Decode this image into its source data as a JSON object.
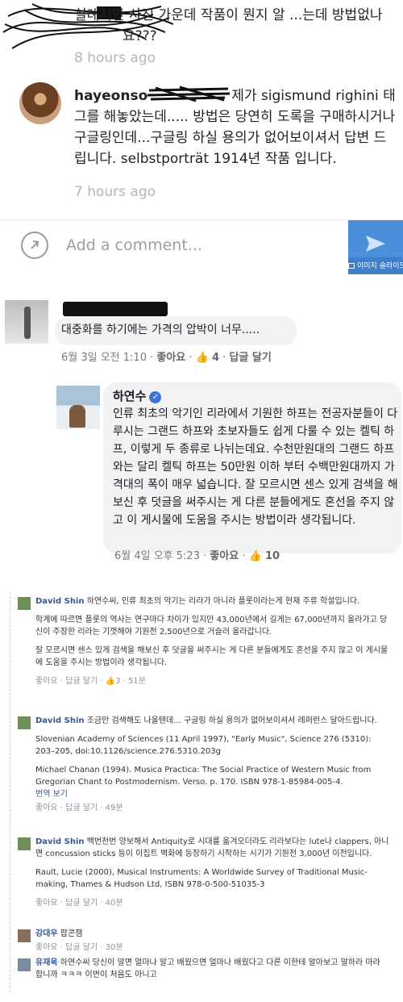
{
  "instagram": {
    "comment1": {
      "text": "실례지만 사진 가운데 작품이 뭔지 알 ...는데 방법없나요???",
      "time": "8 hours ago"
    },
    "comment2": {
      "username": "hayeonso",
      "text": "제가 sigismund righini 태그를 해놓았는데..... 방법은 당연히 도록을 구매하시거나 구글링인데...구글링 하실 용의가 없어보이셔서 답변 드립니다. selbstporträt 1914년 작품 입니다.",
      "time": "7 hours ago"
    },
    "add_comment_placeholder": "Add a comment...",
    "image_slider_label": "이미지 슬라이드"
  },
  "facebook_mobile": {
    "comment1": {
      "text": "대중화를 하기에는 가격의 압박이 너무.....",
      "date": "6월 3일 오전 1:10",
      "like": "좋아요",
      "like_count": "4",
      "reply": "답글 달기"
    },
    "comment2": {
      "name": "하연수",
      "body": "인류 최초의 악기인 리라에서 기원한 하프는 전공자분들이 다루시는 그랜드 하프와 초보자들도 쉽게 다룰 수 있는 켈틱 하프, 이렇게 두 종류로 나뉘는데요. 수천만원대의 그랜드 하프와는 달리 켈틱 하프는 50만원 이하 부터 수백만원대까지 가격대의 폭이 매우 넓습니다. 잘 모르시면 센스 있게 검색을 해보신 후 덧글을 써주시는 게 다른 분들에게도 혼선을 주지 않고 이 게시물에 도움을 주시는 방법이라 생각됩니다.",
      "date": "6월 4일 오후 5:23",
      "like": "좋아요",
      "like_count": "10"
    }
  },
  "facebook_desktop": {
    "comments": [
      {
        "name": "David Shin",
        "lead": "하연수씨, 인류 최초의 악기는 리라가 아니라 플룻이라는게 현재 주류 학설입니다.",
        "paras": [
          "학계에 따르면 플룻의 역사는 연구마다 차이가 있지만 43,000년에서 길게는 67,000년까지 올라가고 당신이 주장한 리라는 기껏해야 기원전 2,500년으로 거슬러 올라갑니다.",
          "잘 모르시면 센스 있게 검색을 해보신 후 덧글을 써주시는 게 다른 분들에게도 혼선을 주지 않고 이 게시물에 도움을 주시는 방법이라 생각됩니다."
        ],
        "meta": "좋아요 · 답글 달기 · 👍3 · 51분"
      },
      {
        "name": "David Shin",
        "lead": "조금만 검색해도 나올텐데... 구글링 하실 용의가 없어보이셔서 레퍼런스 달아드립니다.",
        "paras": [
          "Slovenian Academy of Sciences (11 April 1997), \"Early Music\", Science 276 (5310): 203–205, doi:10.1126/science.276.5310.203g",
          "Michael Chanan (1994). Musica Practica: The Social Practice of Western Music from Gregorian Chant to Postmodernism. Verso. p. 170. ISBN 978-1-85984-005-4."
        ],
        "translate": "번역 보기",
        "meta": "좋아요 · 답글 달기 · 49분"
      },
      {
        "name": "David Shin",
        "lead": "백번천번 양보해서 Antiquity로 시대를 옮겨오더라도 리라보다는 lute나 clappers, 아니면 concussion sticks 등이 이집트 벽화에 등장하기 시작하는 시기가 기원전 3,000년 이전입니다.",
        "paras": [
          "Rault, Lucie (2000), Musical Instruments: A Worldwide Survey of Traditional Music-making, Thames & Hudson Ltd, ISBN 978-0-500-51035-3"
        ],
        "meta": "좋아요 · 답글 달기 · 40분"
      },
      {
        "name": "강대우",
        "lead": "팝콘잼",
        "paras": [],
        "meta": "좋아요 · 답글 달기 · 30분"
      },
      {
        "name": "유재욱",
        "lead": "하연수씨 당신이 알면 얼마나 알고 배웠으면 얼마나 배웠다고 다른 이한테 알아보고 말하라 마라 합니까 ㅋㅋㅋ 이번이 처음도 아니고",
        "paras": [],
        "meta": ""
      }
    ]
  },
  "colors": {
    "fb_link": "#365899",
    "ig_send": "#4b8fdb",
    "meta_gray": "#8d949e"
  }
}
